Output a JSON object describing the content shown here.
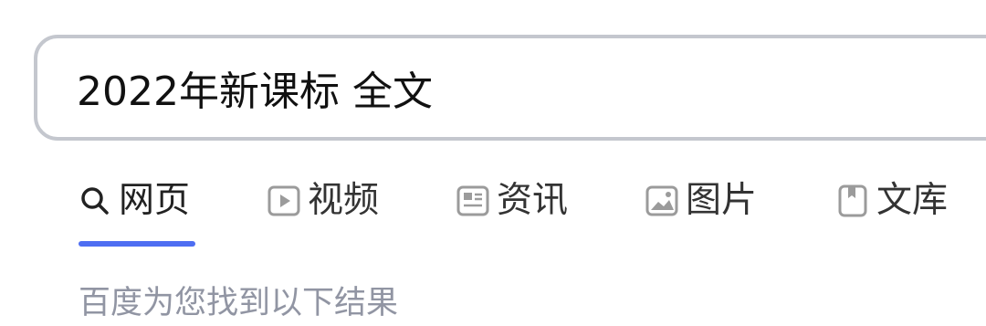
{
  "search": {
    "query": "2022年新课标 全文"
  },
  "tabs": [
    {
      "label": "网页",
      "icon": "search-icon",
      "active": true
    },
    {
      "label": "视频",
      "icon": "video-play-icon",
      "active": false
    },
    {
      "label": "资讯",
      "icon": "news-icon",
      "active": false
    },
    {
      "label": "图片",
      "icon": "image-icon",
      "active": false
    },
    {
      "label": "文库",
      "icon": "document-icon",
      "active": false
    }
  ],
  "result_summary": "百度为您找到以下结果",
  "colors": {
    "accent": "#4e6ef2",
    "muted_text": "#9195a3",
    "border": "#c4c7ce"
  }
}
